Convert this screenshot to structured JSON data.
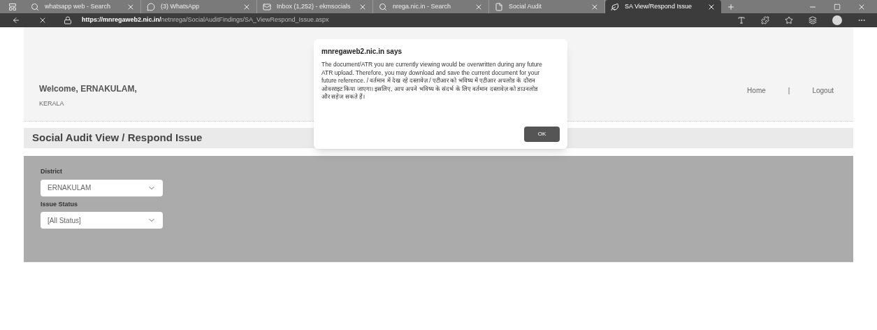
{
  "browser": {
    "tabs": [
      {
        "title": "whatsapp web - Search",
        "kind": "search",
        "selected": false
      },
      {
        "title": "(3) WhatsApp",
        "kind": "chat",
        "selected": false
      },
      {
        "title": "Inbox (1,252) - ekmsocials",
        "kind": "mail",
        "selected": false
      },
      {
        "title": "nrega.nic.in - Search",
        "kind": "search",
        "selected": false
      },
      {
        "title": "Social Audit",
        "kind": "page",
        "selected": false
      },
      {
        "title": "SA View/Respond Issue",
        "kind": "leaf",
        "selected": true
      }
    ],
    "url_host": "https://mnregaweb2.nic.in/",
    "url_path": "netnrega/SocialAuditFindings/SA_ViewRespond_Issue.aspx"
  },
  "header": {
    "welcome": "Welcome, ERNAKULAM,",
    "state": "KERALA",
    "nav": [
      "Home",
      "|",
      "Logout"
    ]
  },
  "page_title": "Social Audit View / Respond Issue",
  "form": {
    "fields": [
      {
        "label": "District",
        "value": "ERNAKULAM"
      },
      {
        "label": "Issue Status",
        "value": "[All Status]"
      }
    ]
  },
  "dialog": {
    "title": "mnregaweb2.nic.in says",
    "message": "The document/ATR you are currently viewing would be overwritten during any future ATR upload. Therefore, you may download and save the current document for your future reference. / वर्तमान में देख रहे दस्तावेज़ / एटीआर को भविष्य में एटीआर अपलोड के दौरान ओवरराइट किया जाएगा। इसलिए, आप अपने भविष्य के संदर्भ के लिए वर्तमान दस्तावेज़ को डाउनलोड और सहेज सकते हैं।",
    "button": "OK"
  }
}
